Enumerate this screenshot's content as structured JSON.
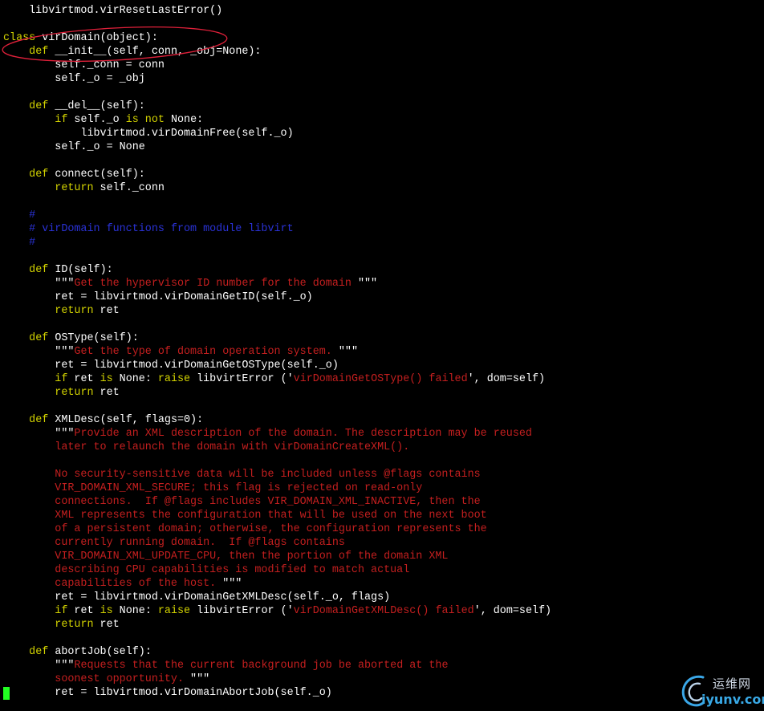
{
  "editor": {
    "background": "#000000",
    "colors": {
      "normal": "#ffffff",
      "keyword": "#d3d300",
      "function": "#4f9eff",
      "string": "#c41f1f",
      "comment": "#2a32d6",
      "cursor": "#22ff22",
      "annotation": "#e0203a"
    },
    "lines": [
      {
        "tokens": [
          {
            "t": "    libvirtmod.virResetLastError()",
            "c": "normal"
          }
        ]
      },
      {
        "tokens": []
      },
      {
        "tokens": [
          {
            "t": "class",
            "c": "keyword"
          },
          {
            "t": " ",
            "c": "normal"
          },
          {
            "t": "virDomain",
            "c": "function"
          },
          {
            "t": "(object):",
            "c": "normal"
          }
        ]
      },
      {
        "tokens": [
          {
            "t": "    ",
            "c": "normal"
          },
          {
            "t": "def",
            "c": "keyword"
          },
          {
            "t": " ",
            "c": "normal"
          },
          {
            "t": "__init__",
            "c": "function"
          },
          {
            "t": "(self, conn, _obj=None):",
            "c": "normal"
          }
        ]
      },
      {
        "tokens": [
          {
            "t": "        self._conn = conn",
            "c": "normal"
          }
        ]
      },
      {
        "tokens": [
          {
            "t": "        self._o = _obj",
            "c": "normal"
          }
        ]
      },
      {
        "tokens": []
      },
      {
        "tokens": [
          {
            "t": "    ",
            "c": "normal"
          },
          {
            "t": "def",
            "c": "keyword"
          },
          {
            "t": " ",
            "c": "normal"
          },
          {
            "t": "__del__",
            "c": "function"
          },
          {
            "t": "(self):",
            "c": "normal"
          }
        ]
      },
      {
        "tokens": [
          {
            "t": "        ",
            "c": "normal"
          },
          {
            "t": "if",
            "c": "keyword"
          },
          {
            "t": " self._o ",
            "c": "normal"
          },
          {
            "t": "is not",
            "c": "keyword"
          },
          {
            "t": " None:",
            "c": "normal"
          }
        ]
      },
      {
        "tokens": [
          {
            "t": "            libvirtmod.virDomainFree(self._o)",
            "c": "normal"
          }
        ]
      },
      {
        "tokens": [
          {
            "t": "        self._o = None",
            "c": "normal"
          }
        ]
      },
      {
        "tokens": []
      },
      {
        "tokens": [
          {
            "t": "    ",
            "c": "normal"
          },
          {
            "t": "def",
            "c": "keyword"
          },
          {
            "t": " ",
            "c": "normal"
          },
          {
            "t": "connect",
            "c": "function"
          },
          {
            "t": "(self):",
            "c": "normal"
          }
        ]
      },
      {
        "tokens": [
          {
            "t": "        ",
            "c": "normal"
          },
          {
            "t": "return",
            "c": "keyword"
          },
          {
            "t": " self._conn",
            "c": "normal"
          }
        ]
      },
      {
        "tokens": []
      },
      {
        "tokens": [
          {
            "t": "    #",
            "c": "comment"
          }
        ]
      },
      {
        "tokens": [
          {
            "t": "    # virDomain functions from module libvirt",
            "c": "comment"
          }
        ]
      },
      {
        "tokens": [
          {
            "t": "    #",
            "c": "comment"
          }
        ]
      },
      {
        "tokens": []
      },
      {
        "tokens": [
          {
            "t": "    ",
            "c": "normal"
          },
          {
            "t": "def",
            "c": "keyword"
          },
          {
            "t": " ",
            "c": "normal"
          },
          {
            "t": "ID",
            "c": "function"
          },
          {
            "t": "(self):",
            "c": "normal"
          }
        ]
      },
      {
        "tokens": [
          {
            "t": "        \"\"\"",
            "c": "normal"
          },
          {
            "t": "Get the hypervisor ID number for the domain ",
            "c": "string"
          },
          {
            "t": "\"\"\"",
            "c": "normal"
          }
        ]
      },
      {
        "tokens": [
          {
            "t": "        ret = libvirtmod.virDomainGetID(self._o)",
            "c": "normal"
          }
        ]
      },
      {
        "tokens": [
          {
            "t": "        ",
            "c": "normal"
          },
          {
            "t": "return",
            "c": "keyword"
          },
          {
            "t": " ret",
            "c": "normal"
          }
        ]
      },
      {
        "tokens": []
      },
      {
        "tokens": [
          {
            "t": "    ",
            "c": "normal"
          },
          {
            "t": "def",
            "c": "keyword"
          },
          {
            "t": " ",
            "c": "normal"
          },
          {
            "t": "OSType",
            "c": "function"
          },
          {
            "t": "(self):",
            "c": "normal"
          }
        ]
      },
      {
        "tokens": [
          {
            "t": "        \"\"\"",
            "c": "normal"
          },
          {
            "t": "Get the type of domain operation system. ",
            "c": "string"
          },
          {
            "t": "\"\"\"",
            "c": "normal"
          }
        ]
      },
      {
        "tokens": [
          {
            "t": "        ret = libvirtmod.virDomainGetOSType(self._o)",
            "c": "normal"
          }
        ]
      },
      {
        "tokens": [
          {
            "t": "        ",
            "c": "normal"
          },
          {
            "t": "if",
            "c": "keyword"
          },
          {
            "t": " ret ",
            "c": "normal"
          },
          {
            "t": "is",
            "c": "keyword"
          },
          {
            "t": " None: ",
            "c": "normal"
          },
          {
            "t": "raise",
            "c": "keyword"
          },
          {
            "t": " libvirtError ('",
            "c": "normal"
          },
          {
            "t": "virDomainGetOSType() failed",
            "c": "string"
          },
          {
            "t": "', dom=self)",
            "c": "normal"
          }
        ]
      },
      {
        "tokens": [
          {
            "t": "        ",
            "c": "normal"
          },
          {
            "t": "return",
            "c": "keyword"
          },
          {
            "t": " ret",
            "c": "normal"
          }
        ]
      },
      {
        "tokens": []
      },
      {
        "tokens": [
          {
            "t": "    ",
            "c": "normal"
          },
          {
            "t": "def",
            "c": "keyword"
          },
          {
            "t": " ",
            "c": "normal"
          },
          {
            "t": "XMLDesc",
            "c": "function"
          },
          {
            "t": "(self, flags=0):",
            "c": "normal"
          }
        ]
      },
      {
        "tokens": [
          {
            "t": "        \"\"\"",
            "c": "normal"
          },
          {
            "t": "Provide an XML description of the domain. The description may be reused",
            "c": "string"
          }
        ]
      },
      {
        "tokens": [
          {
            "t": "        later to relaunch the domain with virDomainCreateXML().",
            "c": "string"
          }
        ]
      },
      {
        "tokens": []
      },
      {
        "tokens": [
          {
            "t": "        No security-sensitive data will be included unless @flags contains",
            "c": "string"
          }
        ]
      },
      {
        "tokens": [
          {
            "t": "        VIR_DOMAIN_XML_SECURE; this flag is rejected on read-only",
            "c": "string"
          }
        ]
      },
      {
        "tokens": [
          {
            "t": "        connections.  If @flags includes VIR_DOMAIN_XML_INACTIVE, then the",
            "c": "string"
          }
        ]
      },
      {
        "tokens": [
          {
            "t": "        XML represents the configuration that will be used on the next boot",
            "c": "string"
          }
        ]
      },
      {
        "tokens": [
          {
            "t": "        of a persistent domain; otherwise, the configuration represents the",
            "c": "string"
          }
        ]
      },
      {
        "tokens": [
          {
            "t": "        currently running domain.  If @flags contains",
            "c": "string"
          }
        ]
      },
      {
        "tokens": [
          {
            "t": "        VIR_DOMAIN_XML_UPDATE_CPU, then the portion of the domain XML",
            "c": "string"
          }
        ]
      },
      {
        "tokens": [
          {
            "t": "        describing CPU capabilities is modified to match actual",
            "c": "string"
          }
        ]
      },
      {
        "tokens": [
          {
            "t": "        capabilities of the host. ",
            "c": "string"
          },
          {
            "t": "\"\"\"",
            "c": "normal"
          }
        ]
      },
      {
        "tokens": [
          {
            "t": "        ret = libvirtmod.virDomainGetXMLDesc(self._o, flags)",
            "c": "normal"
          }
        ]
      },
      {
        "tokens": [
          {
            "t": "        ",
            "c": "normal"
          },
          {
            "t": "if",
            "c": "keyword"
          },
          {
            "t": " ret ",
            "c": "normal"
          },
          {
            "t": "is",
            "c": "keyword"
          },
          {
            "t": " None: ",
            "c": "normal"
          },
          {
            "t": "raise",
            "c": "keyword"
          },
          {
            "t": " libvirtError ('",
            "c": "normal"
          },
          {
            "t": "virDomainGetXMLDesc() failed",
            "c": "string"
          },
          {
            "t": "', dom=self)",
            "c": "normal"
          }
        ]
      },
      {
        "tokens": [
          {
            "t": "        ",
            "c": "normal"
          },
          {
            "t": "return",
            "c": "keyword"
          },
          {
            "t": " ret",
            "c": "normal"
          }
        ]
      },
      {
        "tokens": []
      },
      {
        "tokens": [
          {
            "t": "    ",
            "c": "normal"
          },
          {
            "t": "def",
            "c": "keyword"
          },
          {
            "t": " ",
            "c": "normal"
          },
          {
            "t": "abortJob",
            "c": "function"
          },
          {
            "t": "(self):",
            "c": "normal"
          }
        ]
      },
      {
        "tokens": [
          {
            "t": "        \"\"\"",
            "c": "normal"
          },
          {
            "t": "Requests that the current background job be aborted at the",
            "c": "string"
          }
        ]
      },
      {
        "tokens": [
          {
            "t": "        soonest opportunity. ",
            "c": "string"
          },
          {
            "t": "\"\"\"",
            "c": "normal"
          }
        ]
      },
      {
        "tokens": [
          {
            "t": "        ret = libvirtmod.virDomainAbortJob(self._o)",
            "c": "normal"
          }
        ]
      }
    ]
  },
  "watermark": {
    "chinese_text": "运维网",
    "domain_text": "iyunv.com",
    "icon": "swirl-logo-icon"
  }
}
